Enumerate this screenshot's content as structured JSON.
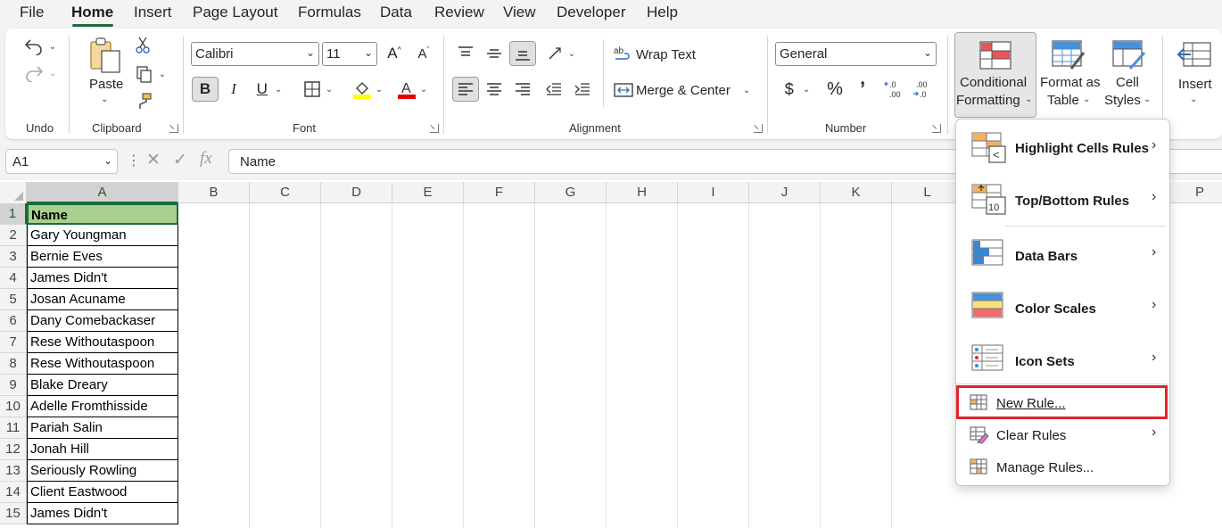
{
  "tabs": [
    "File",
    "Home",
    "Insert",
    "Page Layout",
    "Formulas",
    "Data",
    "Review",
    "View",
    "Developer",
    "Help"
  ],
  "active_tab": "Home",
  "ribbon": {
    "undo_group": "Undo",
    "clipboard": {
      "paste": "Paste",
      "group": "Clipboard"
    },
    "font": {
      "family": "Calibri",
      "size": "11",
      "bold": "B",
      "italic": "I",
      "underline": "U",
      "group": "Font"
    },
    "alignment": {
      "wrap": "Wrap Text",
      "merge": "Merge & Center",
      "group": "Alignment"
    },
    "number": {
      "format": "General",
      "group": "Number"
    },
    "styles": {
      "cond_line1": "Conditional",
      "cond_line2": "Formatting",
      "fmt_line1": "Format as",
      "fmt_line2": "Table",
      "cell_line1": "Cell",
      "cell_line2": "Styles"
    },
    "cells": {
      "insert": "Insert"
    }
  },
  "formula_bar": {
    "cell_ref": "A1",
    "content": "Name"
  },
  "columns": [
    "A",
    "B",
    "C",
    "D",
    "E",
    "F",
    "G",
    "H",
    "I",
    "J",
    "K",
    "L",
    "P"
  ],
  "rows": [
    {
      "num": "1",
      "value": "Name"
    },
    {
      "num": "2",
      "value": "Gary Youngman"
    },
    {
      "num": "3",
      "value": "Bernie Eves"
    },
    {
      "num": "4",
      "value": "James Didn't"
    },
    {
      "num": "5",
      "value": "Josan Acuname"
    },
    {
      "num": "6",
      "value": "Dany Comebackaser"
    },
    {
      "num": "7",
      "value": "Rese Withoutaspoon"
    },
    {
      "num": "8",
      "value": "Rese Withoutaspoon"
    },
    {
      "num": "9",
      "value": "Blake Dreary"
    },
    {
      "num": "10",
      "value": "Adelle Fromthisside"
    },
    {
      "num": "11",
      "value": "Pariah Salin"
    },
    {
      "num": "12",
      "value": "Jonah Hill"
    },
    {
      "num": "13",
      "value": "Seriously Rowling"
    },
    {
      "num": "14",
      "value": "Client Eastwood"
    },
    {
      "num": "15",
      "value": "James Didn't"
    }
  ],
  "menu": {
    "highlight": "Highlight Cells Rules",
    "topbottom": "Top/Bottom Rules",
    "databars": "Data Bars",
    "colorscales": "Color Scales",
    "iconsets": "Icon Sets",
    "newrule": "New Rule...",
    "clearrules": "Clear Rules",
    "managerules": "Manage Rules..."
  },
  "colors": {
    "accent": "#1d6b3c",
    "header_fill": "#a9d08e",
    "highlight_box": "#e0242d"
  }
}
